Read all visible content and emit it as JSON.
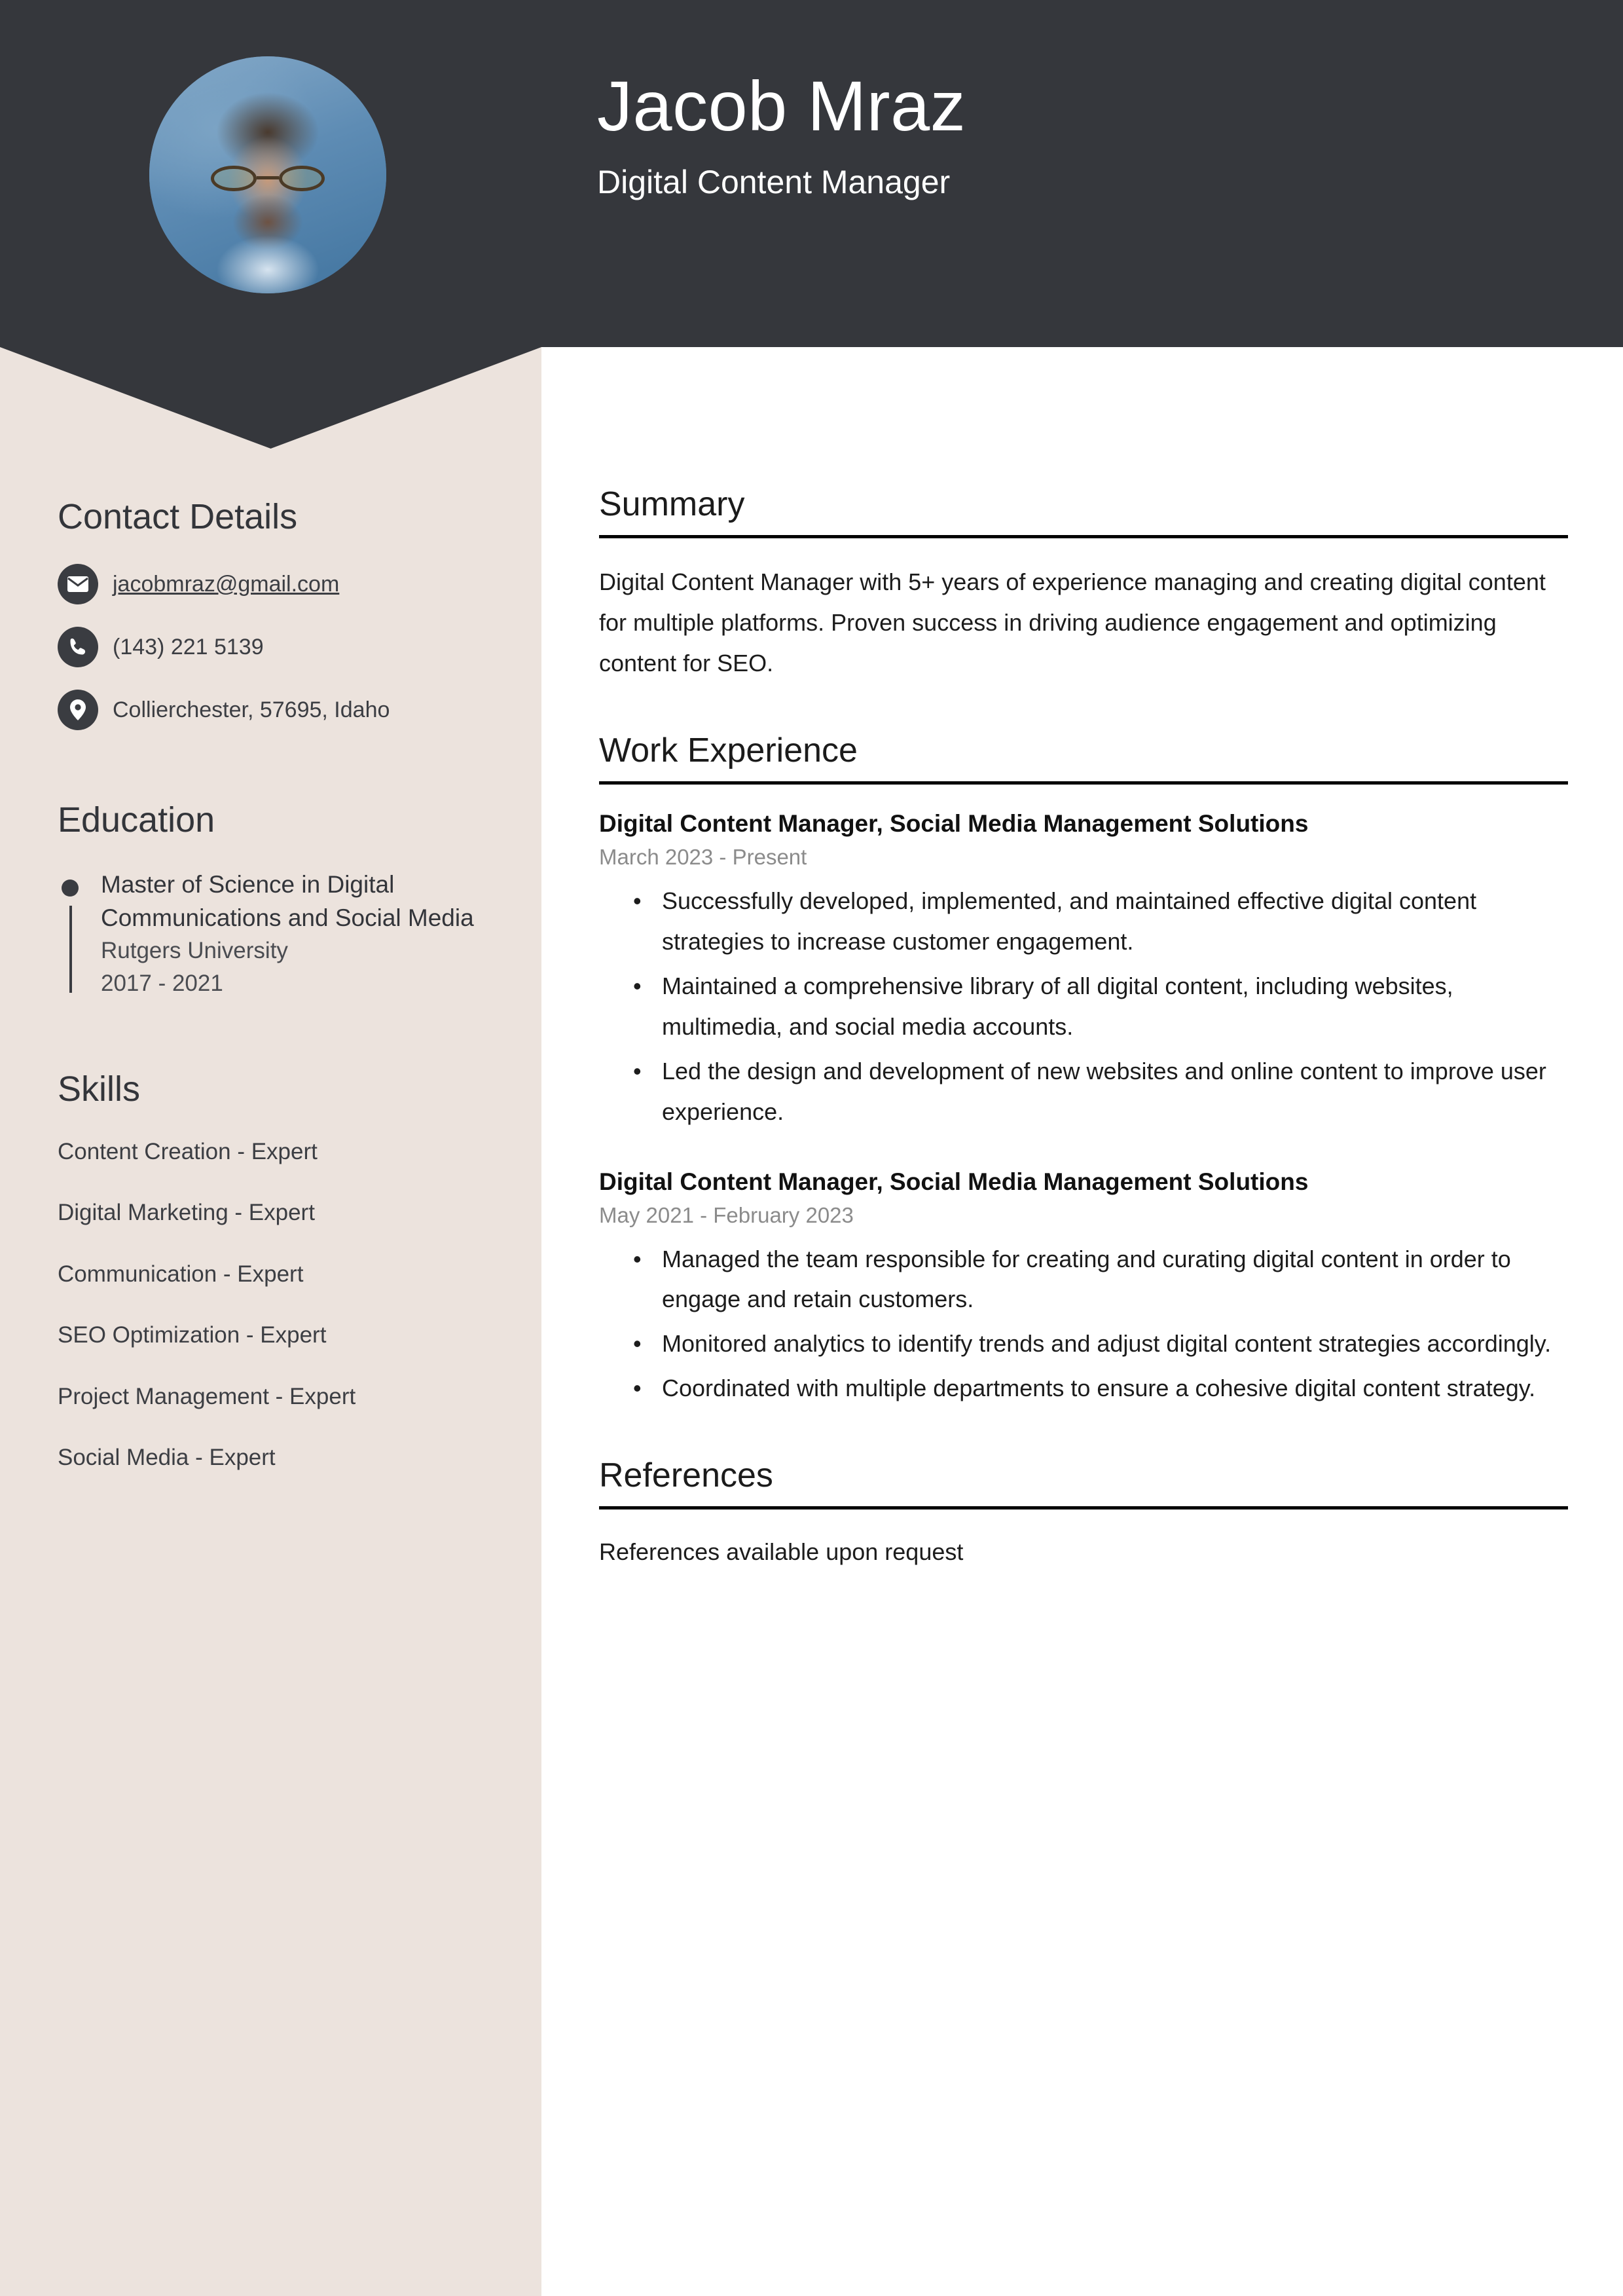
{
  "colors": {
    "header_dark": "#35373c",
    "sidebar_beige": "#ece3dd",
    "page_white": "#ffffff",
    "rule_black": "#000000",
    "muted_date": "#8b8b8b"
  },
  "header": {
    "name": "Jacob Mraz",
    "job_title": "Digital Content Manager",
    "avatar_alt": "profile-photo"
  },
  "sidebar": {
    "contact": {
      "heading": "Contact Details",
      "items": [
        {
          "icon": "envelope-icon",
          "text": "jacobmraz@gmail.com",
          "is_link": true
        },
        {
          "icon": "phone-icon",
          "text": "(143) 221 5139",
          "is_link": false
        },
        {
          "icon": "location-pin-icon",
          "text": "Collierchester, 57695, Idaho",
          "is_link": false
        }
      ]
    },
    "education": {
      "heading": "Education",
      "items": [
        {
          "degree": "Master of Science in Digital Communications and Social Media",
          "school": "Rutgers University",
          "dates": "2017 - 2021"
        }
      ]
    },
    "skills": {
      "heading": "Skills",
      "items": [
        "Content Creation - Expert",
        "Digital Marketing - Expert",
        "Communication - Expert",
        "SEO Optimization - Expert",
        "Project Management - Expert",
        "Social Media - Expert"
      ]
    }
  },
  "main": {
    "summary": {
      "heading": "Summary",
      "text": "Digital Content Manager with 5+ years of experience managing and creating digital content for multiple platforms. Proven success in driving audience engagement and optimizing content for SEO."
    },
    "work_experience": {
      "heading": "Work Experience",
      "jobs": [
        {
          "role": "Digital Content Manager, Social Media Management Solutions",
          "dates": "March 2023 - Present",
          "bullets": [
            "Successfully developed, implemented, and maintained effective digital content strategies to increase customer engagement.",
            "Maintained a comprehensive library of all digital content, including websites, multimedia, and social media accounts.",
            "Led the design and development of new websites and online content to improve user experience."
          ]
        },
        {
          "role": "Digital Content Manager, Social Media Management Solutions",
          "dates": "May 2021 - February 2023",
          "bullets": [
            "Managed the team responsible for creating and curating digital content in order to engage and retain customers.",
            "Monitored analytics to identify trends and adjust digital content strategies accordingly.",
            "Coordinated with multiple departments to ensure a cohesive digital content strategy."
          ]
        }
      ]
    },
    "references": {
      "heading": "References",
      "text": "References available upon request"
    }
  }
}
